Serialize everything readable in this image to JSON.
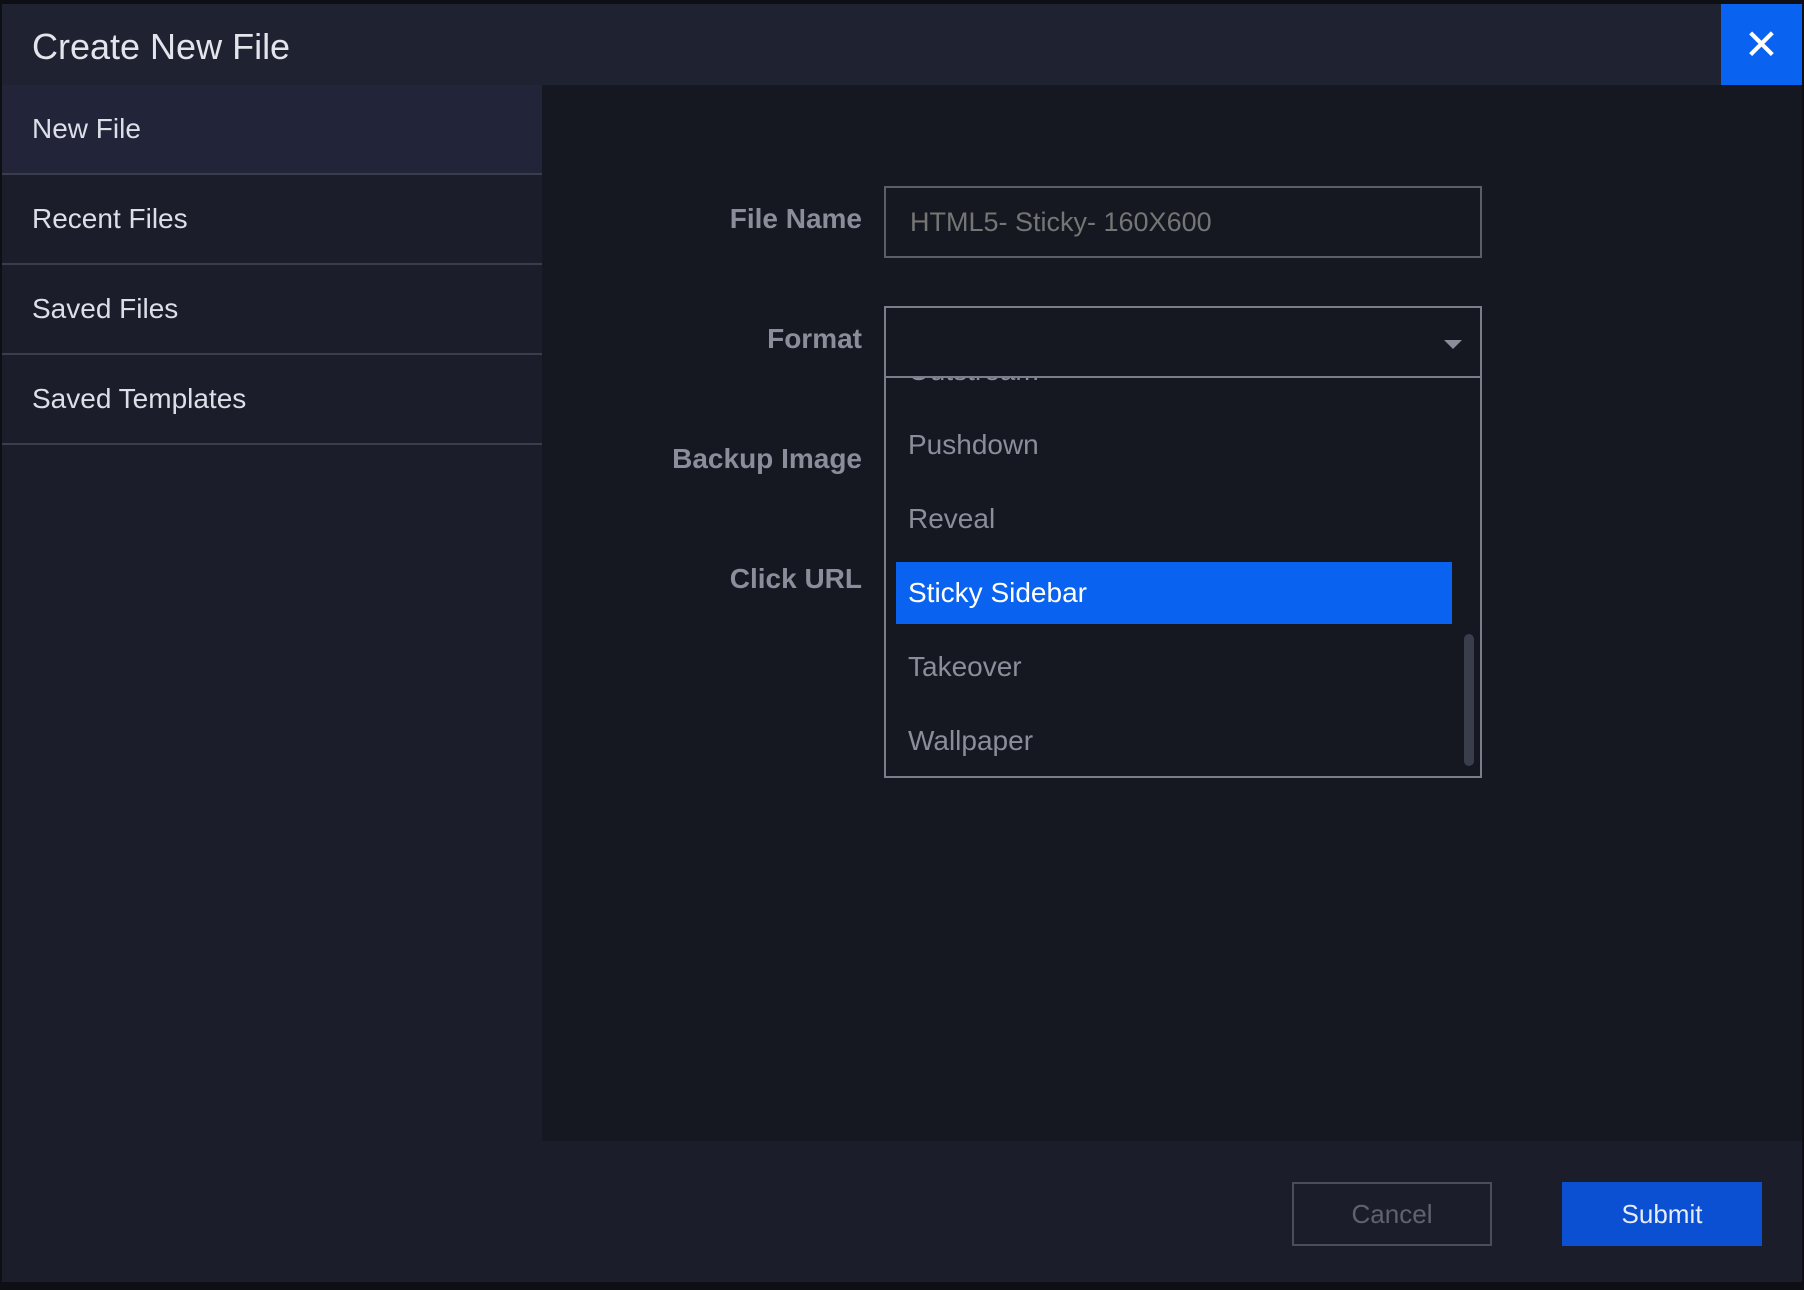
{
  "dialog": {
    "title": "Create New File",
    "close_icon": "close-icon",
    "close_glyph": "✕"
  },
  "sidebar": {
    "items": [
      {
        "label": "New File",
        "active": true
      },
      {
        "label": "Recent Files",
        "active": false
      },
      {
        "label": "Saved Files",
        "active": false
      },
      {
        "label": "Saved Templates",
        "active": false
      }
    ]
  },
  "form": {
    "file_name_label": "File Name",
    "file_name_placeholder": "HTML5- Sticky- 160X600",
    "format_label": "Format",
    "format_value": "",
    "backup_image_label": "Backup Image",
    "click_url_label": "Click URL"
  },
  "dropdown": {
    "options": [
      "Outstream",
      "Pushdown",
      "Reveal",
      "Sticky Sidebar",
      "Takeover",
      "Wallpaper"
    ],
    "selected": "Sticky Sidebar"
  },
  "footer": {
    "cancel_label": "Cancel",
    "submit_label": "Submit"
  },
  "colors": {
    "accent": "#0a63f0",
    "submit": "#0b4fd3",
    "dialog_bg": "#1b1e2a",
    "content_bg": "#151821"
  }
}
